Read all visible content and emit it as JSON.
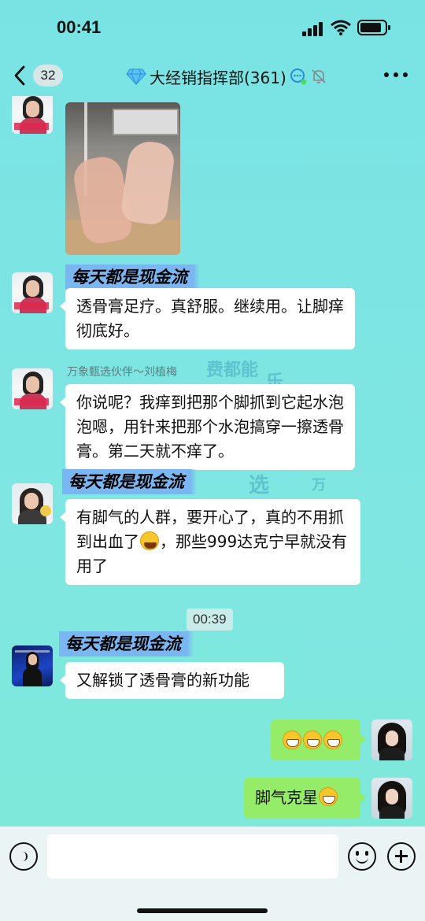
{
  "status_bar": {
    "time": "00:41"
  },
  "header": {
    "unread_count": "32",
    "title": "大经销指挥部(361)"
  },
  "messages": [
    {
      "type": "image",
      "sender_avatar": "avatar-woman-pink-tag",
      "content": "photo of feet wrapped in plastic bags"
    },
    {
      "type": "text",
      "sender_badge": "每天都是现金流",
      "text": "透骨膏足疗。真舒服。继续用。让脚痒彻底好。"
    },
    {
      "type": "text",
      "sender_name": "万象甄选伙伴～刘植梅",
      "text": "你说呢？我痒到把那个脚抓到它起水泡泡嗯，用针来把那个水泡搞穿一擦透骨膏。第二天就不痒了。"
    },
    {
      "type": "text",
      "sender_badge": "每天都是现金流",
      "text_before_emoji": "有脚气的人群，要开心了，真的不用抓到出血了",
      "text_after_emoji": "，那些999达克宁早就没有用了"
    },
    {
      "type": "timestamp",
      "text": "00:39"
    },
    {
      "type": "text",
      "sender_badge": "每天都是现金流",
      "text": "又解锁了透骨膏的新功能"
    },
    {
      "type": "emoji",
      "from_me": true,
      "emoji_count": 3
    },
    {
      "type": "text",
      "from_me": true,
      "text": "脚气克星"
    }
  ],
  "watermarks": [
    "费都能",
    "乐",
    "万",
    "选"
  ],
  "colors": {
    "my_bubble": "#95ec69",
    "name_badge": "#7ab7f2",
    "background": "#7fe6e2"
  }
}
